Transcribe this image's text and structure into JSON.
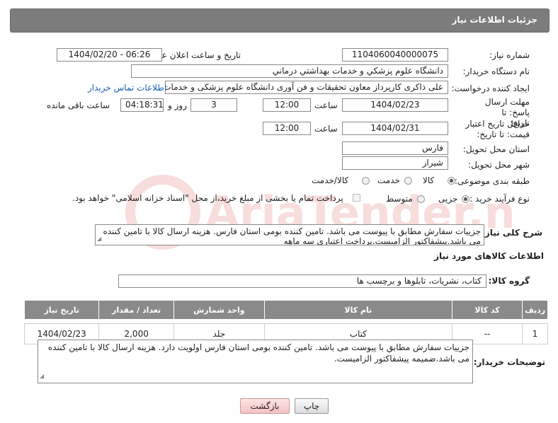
{
  "header": {
    "title": "جزئیات اطلاعات نیاز"
  },
  "form": {
    "need_number": {
      "label": "شماره نیاز:",
      "value": "1104060040000075"
    },
    "announce": {
      "label": "تاریخ و ساعت اعلان عمومی:",
      "value": "1404/02/20 - 06:26"
    },
    "buyer_org": {
      "label": "نام دستگاه خریدار:",
      "value": "دانشگاه علوم پزشکي و خدمات بهداشتي درماني"
    },
    "creator": {
      "label": "ایجاد کننده درخواست:",
      "value": "علی  ذاکری کارپرداز معاون تحقیقات و فن آوری دانشگاه علوم پزشکی و خدمات",
      "link": "اطلاعات تماس خریدار"
    },
    "response_deadline": {
      "label": "مهلت ارسال پاسخ: تا تاریخ:",
      "date": "1404/02/23",
      "time_label": "ساعت",
      "time": "12:00",
      "days": "3",
      "days_label": "روز و",
      "remaining": "04:18:31",
      "remaining_label": "ساعت باقی مانده"
    },
    "price_validity": {
      "label": "حداقل تاریخ اعتبار قیمت: تا تاریخ:",
      "date": "1404/02/31",
      "time_label": "ساعت",
      "time": "12:00"
    },
    "province": {
      "label": "استان محل تحویل:",
      "value": "فارس"
    },
    "city": {
      "label": "شهر محل تحویل:",
      "value": "شیراز"
    },
    "category": {
      "label": "طبقه بندی موضوعی:",
      "options": [
        "کالا",
        "خدمت",
        "کالا/خدمت"
      ],
      "selected": "کالا"
    },
    "process": {
      "label": "نوع فرآیند خرید :",
      "options": [
        "جزیی",
        "متوسط"
      ],
      "selected": "جزیی",
      "payment_note": "پرداخت تمام یا بخشی از مبلغ خرید،از محل \"اسناد خزانه اسلامی\" خواهد بود."
    }
  },
  "description": {
    "label": "شرح کلی نیاز:",
    "value": "جزییات سفارش مطابق با پیوست می باشد. تامین کننده بومی استان فارس. هزینه ارسال کالا با تامین کننده می باشد.پیشفاکتور الزامیست.پرداخت اعتباری سه ماهه"
  },
  "goods": {
    "section_title": "اطلاعات کالاهای مورد نیاز",
    "group_label": "گروه کالا:",
    "group_value": "کتاب، نشریات، تابلوها و برچسب ها",
    "columns": [
      "ردیف",
      "کد کالا",
      "نام کالا",
      "واحد شمارش",
      "تعداد / مقدار",
      "تاریخ نیاز"
    ],
    "rows": [
      {
        "row": "1",
        "code": "--",
        "name": "کتاب",
        "unit": "جلد",
        "qty": "2,000",
        "date": "1404/02/23"
      }
    ]
  },
  "buyer_notes": {
    "label": "توضیحات خریدار:",
    "value": "جزییات سفارش مطابق با پیوست می باشد. تامین کننده بومی استان فارس اولویت دارد. هزینه ارسال کالا با تامین کننده می باشد.ضمیمه پیشفاکتور الزامیست."
  },
  "buttons": {
    "print": "چاپ",
    "back": "بازگشت"
  },
  "watermark": {
    "brand": "AriaTender.net"
  },
  "colors": {
    "header_bg": "#7c7c7c",
    "table_header_bg": "#8a8a8a",
    "link": "#1a5fb4"
  }
}
